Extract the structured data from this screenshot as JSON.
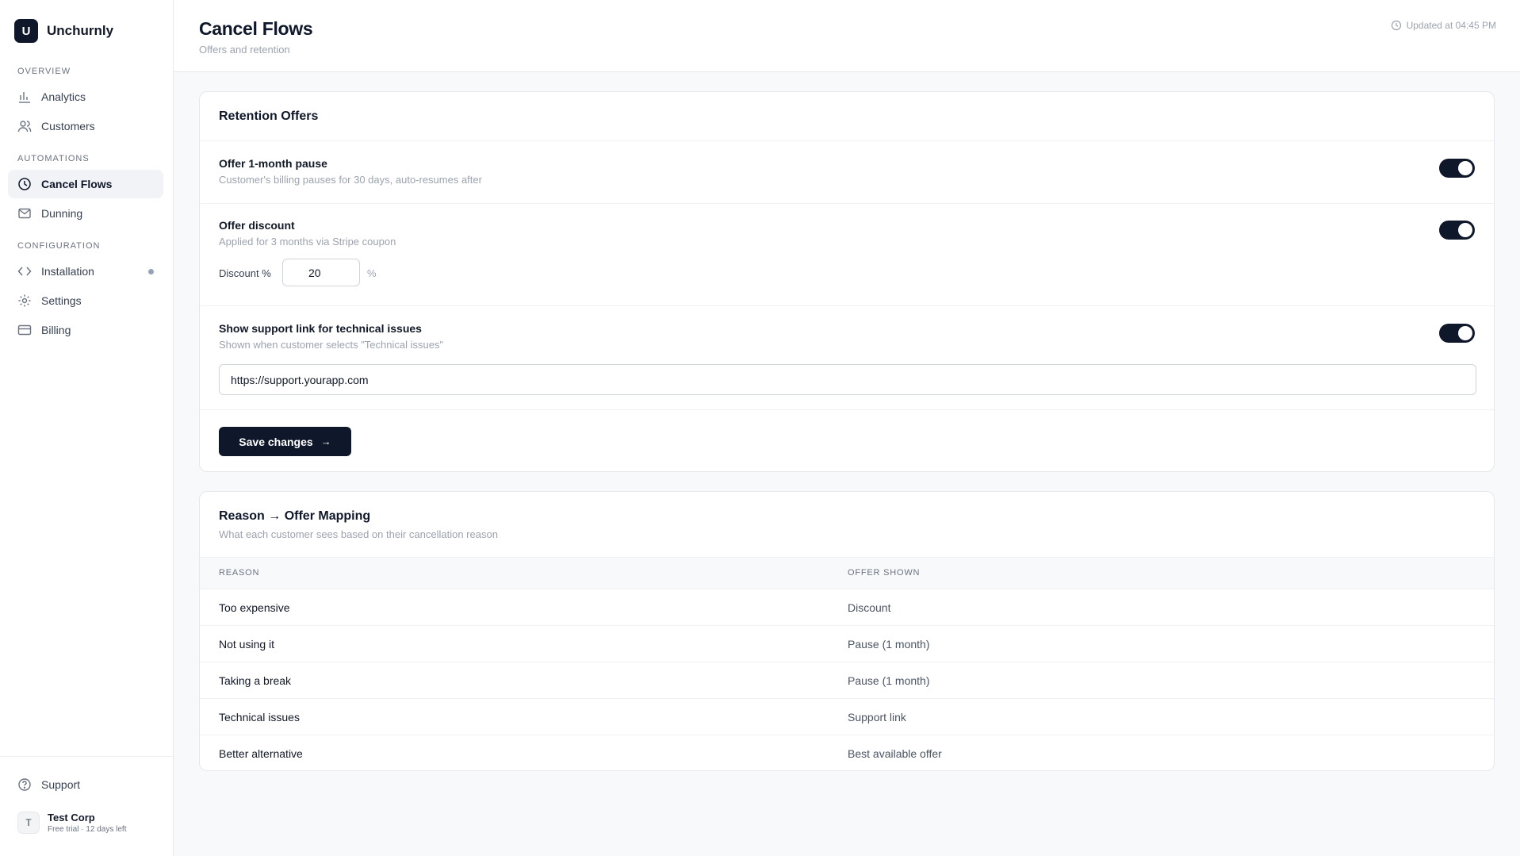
{
  "brand": {
    "mark": "U",
    "name": "Unchurnly"
  },
  "sidebar": {
    "sections": [
      {
        "label": "OVERVIEW"
      },
      {
        "label": "AUTOMATIONS"
      },
      {
        "label": "CONFIGURATION"
      }
    ],
    "items": [
      {
        "label": "Analytics",
        "icon": "bar-chart-icon"
      },
      {
        "label": "Customers",
        "icon": "users-icon"
      },
      {
        "label": "Cancel Flows",
        "icon": "clock-icon",
        "active": true
      },
      {
        "label": "Dunning",
        "icon": "mail-icon"
      },
      {
        "label": "Installation",
        "icon": "code-icon",
        "has_dot": true
      },
      {
        "label": "Settings",
        "icon": "gear-icon"
      },
      {
        "label": "Billing",
        "icon": "credit-card-icon"
      }
    ],
    "support_label": "Support",
    "account": {
      "avatar": "T",
      "name": "Test Corp",
      "subtitle": "Free trial · 12 days left"
    }
  },
  "header": {
    "title": "Cancel Flows",
    "subtitle": "Offers and retention",
    "updated": "Updated at 04:45 PM"
  },
  "retention": {
    "title": "Retention Offers",
    "offers": [
      {
        "title": "Offer 1-month pause",
        "description": "Customer's billing pauses for 30 days, auto-resumes after",
        "enabled": true
      },
      {
        "title": "Offer discount",
        "description": "Applied for 3 months via Stripe coupon",
        "enabled": true
      },
      {
        "title": "Show support link for technical issues",
        "description": "Shown when customer selects \"Technical issues\"",
        "enabled": true
      }
    ],
    "discount_label": "Discount %",
    "discount_value": "20",
    "percent_symbol": "%",
    "support_url": "https://support.yourapp.com",
    "save_label": "Save changes",
    "save_arrow": "→"
  },
  "mapping": {
    "title": "Reason → Offer Mapping",
    "description": "What each customer sees based on their cancellation reason",
    "columns": [
      "REASON",
      "OFFER SHOWN"
    ],
    "rows": [
      {
        "reason": "Too expensive",
        "offer": "Discount"
      },
      {
        "reason": "Not using it",
        "offer": "Pause (1 month)"
      },
      {
        "reason": "Taking a break",
        "offer": "Pause (1 month)"
      },
      {
        "reason": "Technical issues",
        "offer": "Support link"
      },
      {
        "reason": "Better alternative",
        "offer": "Best available offer"
      }
    ]
  },
  "colors": {
    "primary": "#0f172a",
    "muted": "#9ca3af",
    "border": "#e5e7eb",
    "background": "#f8f9fb"
  }
}
